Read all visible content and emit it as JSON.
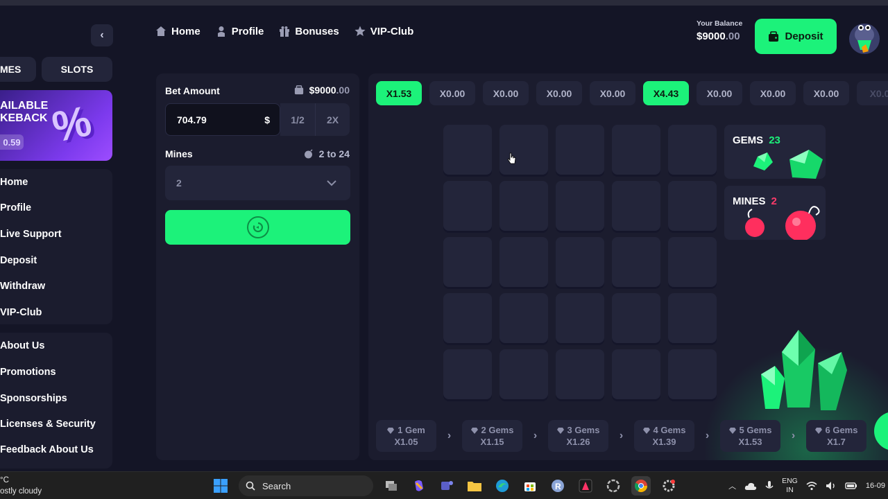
{
  "header": {
    "nav": [
      {
        "label": "Home",
        "icon": "home-icon"
      },
      {
        "label": "Profile",
        "icon": "user-icon"
      },
      {
        "label": "Bonuses",
        "icon": "gift-icon"
      },
      {
        "label": "VIP-Club",
        "icon": "star-icon"
      }
    ],
    "balance_label": "Your Balance",
    "balance_int": "$9000",
    "balance_dec": ".00",
    "deposit_label": "Deposit"
  },
  "sidebar": {
    "tab_games": "MES",
    "tab_slots": "SLOTS",
    "cashback_line1": "AILABLE",
    "cashback_line2": "KEBACK",
    "cashback_amount": "0.59",
    "cashback_symbol": "%",
    "menu1": [
      "Home",
      "Profile",
      "Live Support",
      "Deposit",
      "Withdraw",
      "VIP-Club"
    ],
    "menu2": [
      "About Us",
      "Promotions",
      "Sponsorships",
      "Licenses & Security",
      "Feedback About Us"
    ]
  },
  "bet": {
    "label": "Bet Amount",
    "balance_int": "$9000",
    "balance_dec": ".00",
    "amount": "704.79",
    "currency": "$",
    "half": "1/2",
    "double": "2X",
    "mines_label": "Mines",
    "mines_range": "2 to 24",
    "mines_value": "2"
  },
  "game": {
    "multipliers": [
      {
        "label": "X1.53",
        "active": true
      },
      {
        "label": "X0.00",
        "active": false
      },
      {
        "label": "X0.00",
        "active": false
      },
      {
        "label": "X0.00",
        "active": false
      },
      {
        "label": "X0.00",
        "active": false
      },
      {
        "label": "X4.43",
        "active": true
      },
      {
        "label": "X0.00",
        "active": false
      },
      {
        "label": "X0.00",
        "active": false
      },
      {
        "label": "X0.00",
        "active": false
      },
      {
        "label": "X0.0",
        "active": false
      }
    ],
    "gems_label": "GEMS",
    "gems_count": "23",
    "mines_label": "MINES",
    "mines_count": "2",
    "ladder": [
      {
        "gems": "1 Gem",
        "mult": "X1.05"
      },
      {
        "gems": "2 Gems",
        "mult": "X1.15"
      },
      {
        "gems": "3 Gems",
        "mult": "X1.26"
      },
      {
        "gems": "4 Gems",
        "mult": "X1.39"
      },
      {
        "gems": "5 Gems",
        "mult": "X1.53"
      },
      {
        "gems": "6 Gems",
        "mult": "X1.7"
      }
    ]
  },
  "taskbar": {
    "weather_temp": "°C",
    "weather_desc": "ostly cloudy",
    "search_placeholder": "Search",
    "lang_line1": "ENG",
    "lang_line2": "IN",
    "date": "16-09"
  },
  "colors": {
    "accent": "#1cf27a",
    "background": "#141526",
    "panel": "#1b1c2e",
    "tile": "#23253a",
    "mine": "#ff3b6b"
  }
}
